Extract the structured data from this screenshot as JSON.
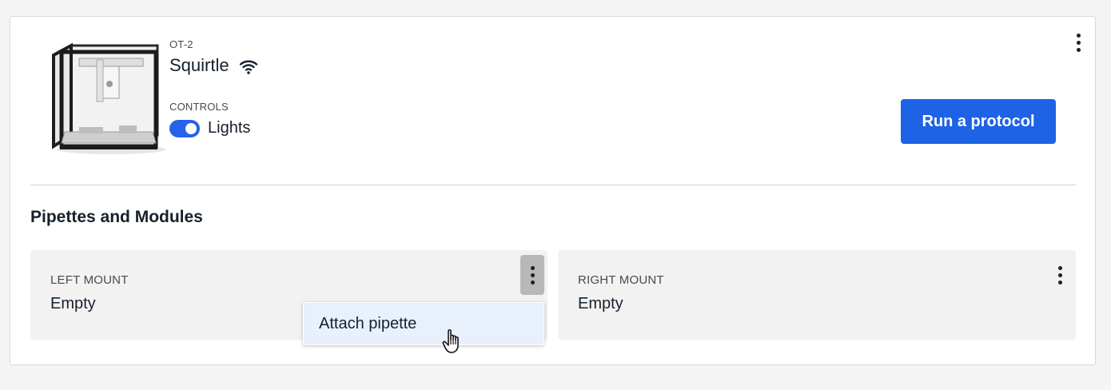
{
  "robot": {
    "model": "OT-2",
    "name": "Squirtle",
    "connection_icon": "wifi-icon",
    "controls_label": "CONTROLS",
    "lights_label": "Lights",
    "lights_on": true
  },
  "actions": {
    "run_protocol_label": "Run a protocol"
  },
  "pipettes_section": {
    "title": "Pipettes and Modules",
    "mounts": [
      {
        "label": "LEFT MOUNT",
        "value": "Empty"
      },
      {
        "label": "RIGHT MOUNT",
        "value": "Empty"
      }
    ]
  },
  "dropdown": {
    "items": [
      {
        "label": "Attach pipette"
      }
    ]
  },
  "colors": {
    "accent": "#1e63e6",
    "toggle_on": "#2563e8",
    "dropdown_hover": "#e8f0fb"
  }
}
